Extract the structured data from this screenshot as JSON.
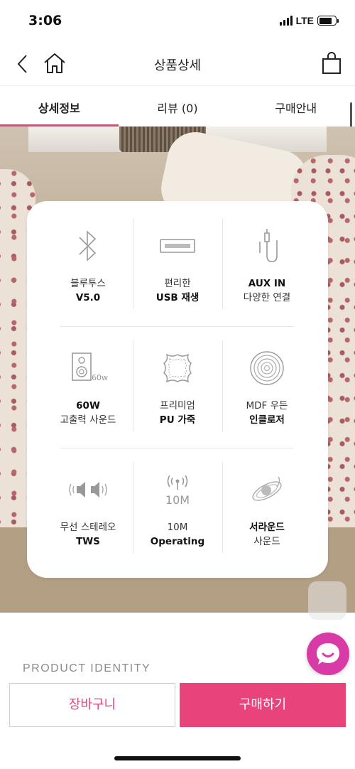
{
  "status_bar": {
    "time": "3:06",
    "network": "LTE",
    "battery_level": 0.78
  },
  "header": {
    "title": "상품상세",
    "back_icon": "chevron-left-icon",
    "home_icon": "home-icon",
    "cart_icon": "shopping-bag-icon"
  },
  "tabs": [
    {
      "label": "상세정보",
      "active": true
    },
    {
      "label": "리뷰 (0)",
      "active": false
    },
    {
      "label": "구매안내",
      "active": false
    }
  ],
  "features": [
    {
      "icon": "bluetooth-icon",
      "line1": "블루투스",
      "line2": "V5.0",
      "bold_line": 2
    },
    {
      "icon": "usb-icon",
      "line1": "편리한",
      "line2": "USB 재생",
      "bold_line": 2
    },
    {
      "icon": "aux-cable-icon",
      "line1": "AUX IN",
      "line2": "다양한 연결",
      "bold_line": 1
    },
    {
      "icon": "speaker-60w-icon",
      "icon_text": "60w",
      "line1": "60W",
      "line2": "고출력 사운드",
      "bold_line": 1
    },
    {
      "icon": "leather-icon",
      "line1": "프리미엄",
      "line2": "PU 가죽",
      "bold_line": 2
    },
    {
      "icon": "wood-rings-icon",
      "line1": "MDF 우든",
      "line2": "인클로저",
      "bold_line": 2
    },
    {
      "icon": "wireless-stereo-icon",
      "line1": "무선 스테레오",
      "line2": "TWS",
      "bold_line": 2
    },
    {
      "icon": "antenna-10m-icon",
      "icon_text": "10M",
      "line1": "10M",
      "line2": "Operating",
      "bold_line": 2
    },
    {
      "icon": "surround-icon",
      "line1": "서라운드",
      "line2": "사운드",
      "bold_line": 1
    }
  ],
  "section_heading": "PRODUCT IDENTITY",
  "bottom_bar": {
    "add_to_cart": "장바구니",
    "buy": "구매하기"
  },
  "colors": {
    "accent": "#e8437b",
    "chat": "#d83aa6"
  },
  "floating": {
    "scroll_top_icon": "chevron-up-icon",
    "chat_icon": "chat-bubble-icon"
  }
}
